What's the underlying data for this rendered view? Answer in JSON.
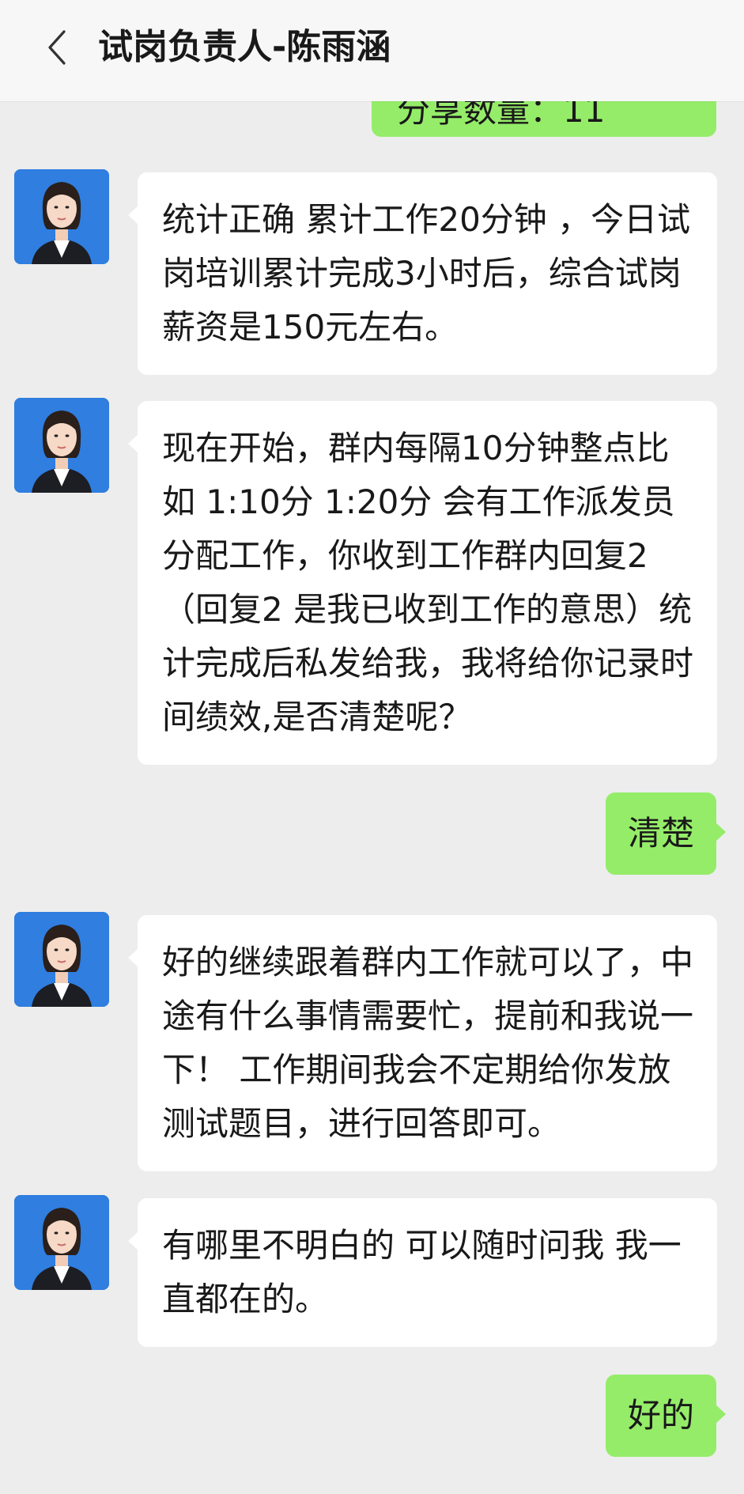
{
  "header": {
    "back_icon": "chevron-left-icon",
    "title": "试岗负责人-陈雨涵"
  },
  "colors": {
    "background": "#ededed",
    "header": "#f7f7f7",
    "incoming_bubble": "#ffffff",
    "outgoing_bubble": "#95ec69",
    "avatar_background": "#2f7ee0"
  },
  "messages": [
    {
      "side": "out",
      "text": "分享数量：11"
    },
    {
      "side": "in",
      "text": "统计正确  累计工作20分钟 ，今日试岗培训累计完成3小时后，综合试岗薪资是150元左右。"
    },
    {
      "side": "in",
      "text": "现在开始，群内每隔10分钟整点比如 1:10分  1:20分 会有工作派发员分配工作，你收到工作群内回复2（回复2 是我已收到工作的意思）统计完成后私发给我，我将给你记录时间绩效,是否清楚呢？"
    },
    {
      "side": "out",
      "text": "清楚"
    },
    {
      "side": "in",
      "text": "好的继续跟着群内工作就可以了，中途有什么事情需要忙，提前和我说一下！  工作期间我会不定期给你发放测试题目，进行回答即可。"
    },
    {
      "side": "in",
      "text": "有哪里不明白的 可以随时问我 我一直都在的。"
    },
    {
      "side": "out",
      "text": "好的"
    }
  ]
}
